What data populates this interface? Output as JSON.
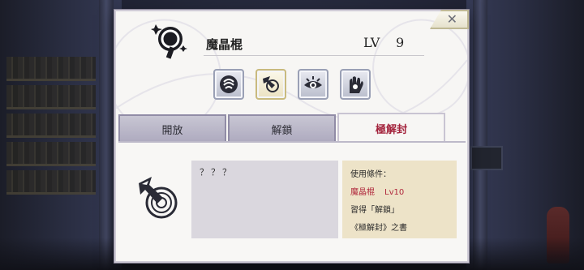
{
  "item": {
    "name": "魔晶棍",
    "level_label": "LV",
    "level": "9"
  },
  "skills": [
    {
      "icon": "hand-swirl-skill-icon",
      "selected": false
    },
    {
      "icon": "pickaxe-swirl-skill-icon",
      "selected": true
    },
    {
      "icon": "eye-skill-icon",
      "selected": false
    },
    {
      "icon": "hand-flame-skill-icon",
      "selected": false
    }
  ],
  "tabs": [
    {
      "label": "開放",
      "active": false
    },
    {
      "label": "解鎖",
      "active": false
    },
    {
      "label": "極解封",
      "active": true
    }
  ],
  "description": "？？？",
  "conditions": {
    "title": "使用條件：",
    "required_item": "魔晶棍",
    "required_level": "Lv10",
    "line2": "習得「解鎖」",
    "line3": "《極解封》之書"
  },
  "colors": {
    "active_tab_text": "#a3233c",
    "requirement_text": "#b0283c",
    "condition_bg": "#ede3c8"
  }
}
